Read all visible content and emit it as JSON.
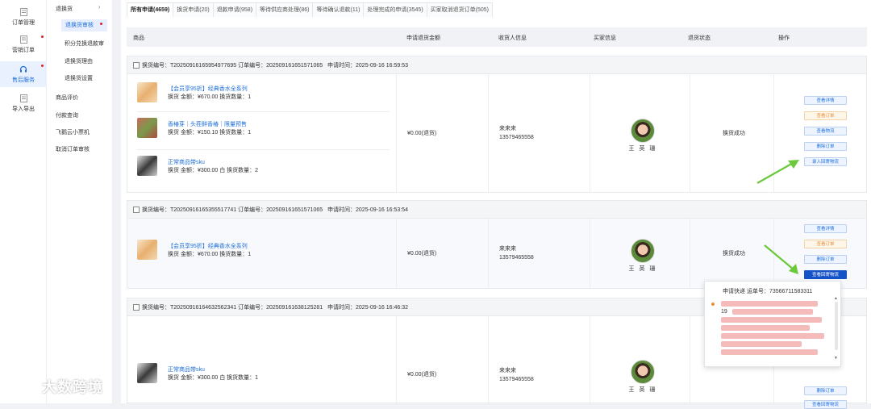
{
  "rail": [
    {
      "label": "订单管理",
      "dot": false
    },
    {
      "label": "营销订单",
      "dot": true
    },
    {
      "label": "售后服务",
      "dot": true,
      "active": true
    },
    {
      "label": "导入导出",
      "dot": false
    }
  ],
  "submenu": {
    "group": "退换货",
    "items": [
      "退换货审核",
      "积分兑换退款审",
      "退换货理由",
      "退换货设置"
    ],
    "extra": [
      "商品评价",
      "付款查询",
      "飞鹅云小票机",
      "取消订单审核"
    ]
  },
  "tabs": [
    "所有申请(4659)",
    "换货申请(20)",
    "退款申请(958)",
    "等待供应商处理(86)",
    "等待确认退款(11)",
    "处理完成的申请(3545)",
    "买家取消退货订单(505)"
  ],
  "table_head": [
    "商品",
    "申请退货金额",
    "收货人信息",
    "买家信息",
    "退货状态",
    "操作"
  ],
  "cards": [
    {
      "header": {
        "exchange_no": "换货编号：T20250916165954977695",
        "order_no": "订单编号：202509161651571065",
        "time": "申请时间：2025-09-16 16:59:53"
      },
      "products": [
        {
          "name": "【会员享95折】经典香水全系列",
          "meta": "换货 金额：¥670.00   换货数量：1",
          "color": "#f0d0a0"
        },
        {
          "name": "香椿芽｜头茬鲜香椿｜限量预售",
          "meta": "换货 金额：¥150.10   换货数量：1",
          "color": "#8aa65a"
        },
        {
          "name": "正常商品带sku",
          "meta": "换货 金额：¥300.00  白  换货数量：2",
          "color": "#5a5a5a"
        }
      ],
      "amount": "¥0.00(退货)",
      "recipient": {
        "name": "来来来",
        "phone": "13579465558"
      },
      "buyer": "王 英 珊",
      "status": "换货成功",
      "buttons": [
        {
          "label": "查看详情",
          "style": "normal"
        },
        {
          "label": "查看订单",
          "style": "orange"
        },
        {
          "label": "查看物流",
          "style": "normal"
        },
        {
          "label": "删除订单",
          "style": "normal"
        },
        {
          "label": "录入回寄物流",
          "style": "normal"
        }
      ]
    },
    {
      "header": {
        "exchange_no": "换货编号：T20250916165355517741",
        "order_no": "订单编号：202509161651571065",
        "time": "申请时间：2025-09-16 16:53:54"
      },
      "products": [
        {
          "name": "【会员享95折】经典香水全系列",
          "meta": "换货 金额：¥670.00   换货数量：1",
          "color": "#f0d0a0"
        }
      ],
      "amount": "¥0.00(退货)",
      "recipient": {
        "name": "来来来",
        "phone": "13579465558"
      },
      "buyer": "王 英 珊",
      "status": "换货成功",
      "buttons": [
        {
          "label": "查看详情",
          "style": "normal"
        },
        {
          "label": "查看订单",
          "style": "orange"
        },
        {
          "label": "删除订单",
          "style": "normal"
        },
        {
          "label": "查看回寄物流",
          "style": "primary"
        }
      ]
    },
    {
      "header": {
        "exchange_no": "换货编号：T20250916164632562341",
        "order_no": "订单编号：202509161638125281",
        "time": "申请时间：2025-09-16 16:46:32"
      },
      "products": [
        {
          "name": "正常商品带sku",
          "meta": "换货 金额：¥300.00  白  换货数量：1",
          "color": "#5a5a5a"
        }
      ],
      "amount": "¥0.00(退货)",
      "recipient": {
        "name": "来来来",
        "phone": "13579465558"
      },
      "buyer": "王 英 珊",
      "buttons": [
        {
          "label": "删除订单",
          "style": "normal"
        },
        {
          "label": "查看回寄物流",
          "style": "normal"
        }
      ]
    }
  ],
  "popup": {
    "head": "申请快递   运单号：73566711583311",
    "date_prefix": "19"
  },
  "watermark": "大数跨境",
  "colors": {
    "accent": "#1e6fdb",
    "primary_button": "#1452c8",
    "arrow": "#6cc93a",
    "dot": "#e02020"
  }
}
